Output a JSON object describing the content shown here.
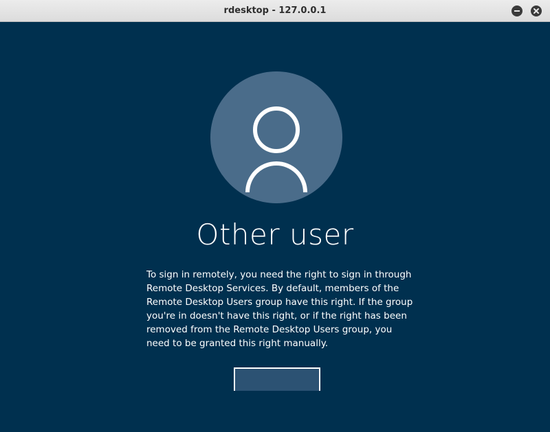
{
  "window": {
    "title": "rdesktop - 127.0.0.1",
    "controls": [
      "minimize-icon",
      "close-icon"
    ]
  },
  "login": {
    "avatar_icon": "user-icon",
    "username": "Other user",
    "message": "To sign in remotely, you need the right to sign in through\nRemote Desktop Services. By default, members of the\nRemote Desktop Users group have this right. If the group\nyou're in doesn't have this right, or if the right has been\nremoved from the Remote Desktop Users group, you\nneed to be granted this right manually."
  },
  "colors": {
    "background": "#00304f",
    "avatar_bg": "#4a6c8a",
    "text": "#ffffff",
    "titlebar": "#e2e2e2"
  }
}
